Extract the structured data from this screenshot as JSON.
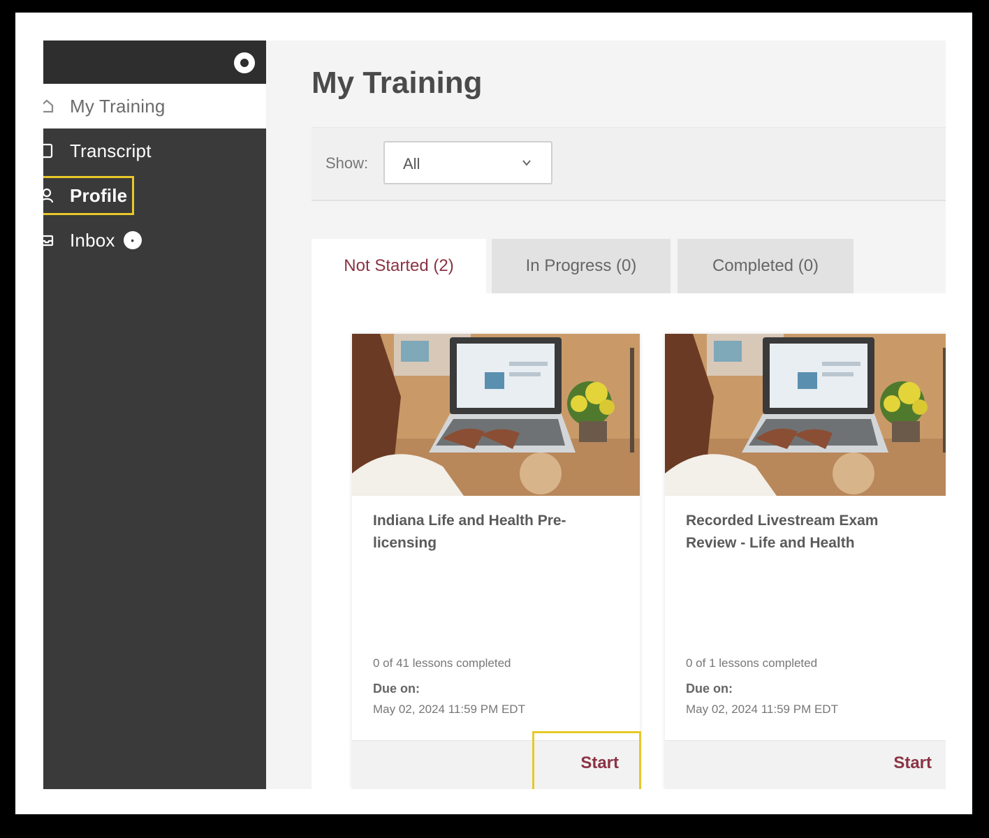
{
  "sidebar": {
    "items": [
      {
        "label": "My Training",
        "icon": "home-icon"
      },
      {
        "label": "Transcript",
        "icon": "document-icon"
      },
      {
        "label": "Profile",
        "icon": "user-icon"
      },
      {
        "label": "Inbox",
        "icon": "inbox-icon"
      }
    ]
  },
  "main": {
    "title": "My Training",
    "filter": {
      "label": "Show:",
      "value": "All"
    },
    "tabs": [
      {
        "label": "Not Started (2)"
      },
      {
        "label": "In Progress (0)"
      },
      {
        "label": "Completed (0)"
      }
    ],
    "cards": [
      {
        "title": "Indiana Life and Health Pre-licensing",
        "progress": "0 of 41 lessons completed",
        "due_label": "Due on:",
        "due_date": "May 02, 2024 11:59 PM EDT",
        "action": "Start"
      },
      {
        "title": "Recorded Livestream Exam Review - Life and Health",
        "progress": "0 of 1 lessons completed",
        "due_label": "Due on:",
        "due_date": "May 02, 2024 11:59 PM EDT",
        "action": "Start"
      }
    ]
  },
  "colors": {
    "sidebar_bg": "#3a3a3a",
    "accent": "#8a3344",
    "highlight": "#e9c82a"
  }
}
